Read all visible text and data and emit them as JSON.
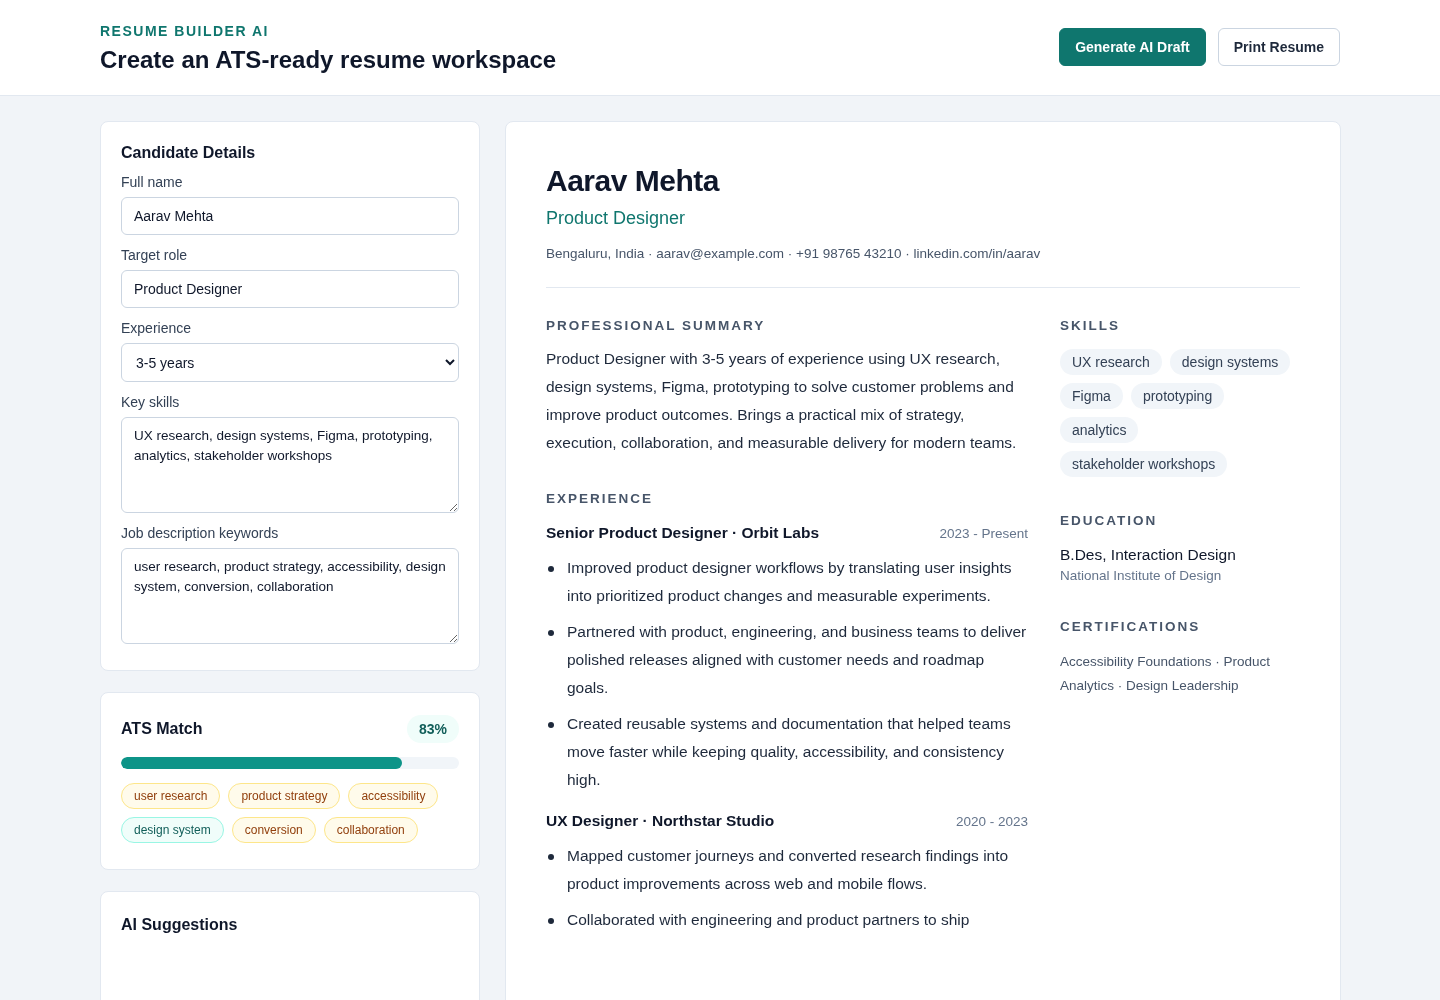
{
  "header": {
    "eyebrow": "RESUME BUILDER AI",
    "title": "Create an ATS-ready resume workspace",
    "buttons": [
      {
        "label": "Generate AI Draft",
        "kind": "primary"
      },
      {
        "label": "Print Resume",
        "kind": "secondary"
      }
    ]
  },
  "form": {
    "title": "Candidate Details",
    "fields": [
      {
        "label": "Full name",
        "kind": "text",
        "value": "Aarav Mehta"
      },
      {
        "label": "Target role",
        "kind": "text",
        "value": "Product Designer"
      },
      {
        "label": "Experience",
        "kind": "select",
        "value": "3-5 years"
      },
      {
        "label": "Key skills",
        "kind": "textarea",
        "value": "UX research, design systems, Figma, prototyping, analytics, stakeholder workshops"
      },
      {
        "label": "Job description keywords",
        "kind": "textarea",
        "value": "user research, product strategy, accessibility, design system, conversion, collaboration"
      }
    ]
  },
  "ats": {
    "title": "ATS Match",
    "score": "83%",
    "level": 0.83,
    "keywords": [
      {
        "label": "user research",
        "matched": false
      },
      {
        "label": "product strategy",
        "matched": false
      },
      {
        "label": "accessibility",
        "matched": false
      },
      {
        "label": "design system",
        "matched": true
      },
      {
        "label": "conversion",
        "matched": false
      },
      {
        "label": "collaboration",
        "matched": false
      }
    ]
  },
  "suggestions": {
    "title": "AI Suggestions"
  },
  "resume": {
    "name": "Aarav Mehta",
    "role": "Product Designer",
    "contact": "Bengaluru, India · aarav@example.com · +91 98765 43210 · linkedin.com/in/aarav",
    "summary_heading": "PROFESSIONAL SUMMARY",
    "summary": "Product Designer with 3-5 years of experience using UX research, design systems, Figma, prototyping to solve customer problems and improve product outcomes. Brings a practical mix of strategy, execution, collaboration, and measurable delivery for modern teams.",
    "experience_heading": "EXPERIENCE",
    "jobs": [
      {
        "title": "Senior Product Designer · Orbit Labs",
        "dates": "2023 - Present",
        "bullets": [
          "Improved product designer workflows by translating user insights into prioritized product changes and measurable experiments.",
          "Partnered with product, engineering, and business teams to deliver polished releases aligned with customer needs and roadmap goals.",
          "Created reusable systems and documentation that helped teams move faster while keeping quality, accessibility, and consistency high."
        ]
      },
      {
        "title": "UX Designer · Northstar Studio",
        "dates": "2020 - 2023",
        "bullets": [
          "Mapped customer journeys and converted research findings into product improvements across web and mobile flows.",
          "Collaborated with engineering and product partners to ship"
        ]
      }
    ],
    "skills_heading": "SKILLS",
    "skills": [
      "UX research",
      "design systems",
      "Figma",
      "prototyping",
      "analytics",
      "stakeholder workshops"
    ],
    "education_heading": "EDUCATION",
    "degree": "B.Des, Interaction Design",
    "school": "National Institute of Design",
    "certifications_heading": "CERTIFICATIONS",
    "certifications": "Accessibility Foundations · Product Analytics · Design Leadership"
  }
}
